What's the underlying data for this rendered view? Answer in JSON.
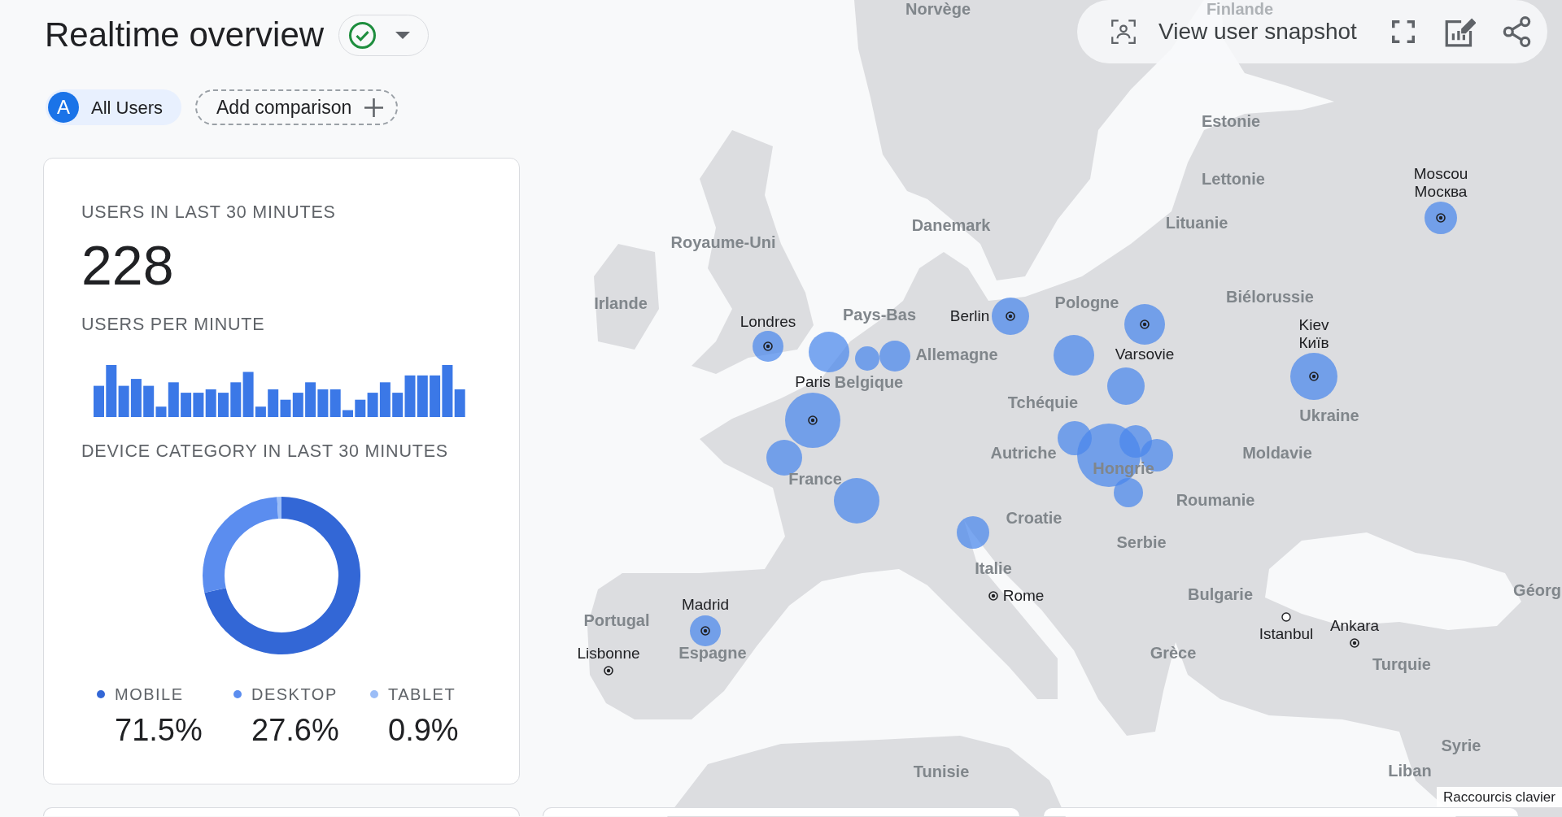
{
  "header": {
    "title": "Realtime overview",
    "status_ok": true
  },
  "comparisons": {
    "segments": [
      {
        "letter": "A",
        "label": "All Users"
      }
    ],
    "add_label": "Add comparison"
  },
  "toolbar": {
    "snapshot_label": "View user snapshot"
  },
  "realtime_card": {
    "users_label": "USERS IN LAST 30 MINUTES",
    "users_value": "228",
    "per_minute_label": "USERS PER MINUTE",
    "device_label": "DEVICE CATEGORY IN LAST 30 MINUTES",
    "device_chart": {
      "chart_data": {
        "type": "donut",
        "values": [
          71.5,
          27.6,
          0.9
        ]
      }
    },
    "legend": [
      {
        "label": "MOBILE",
        "value": "71.5%",
        "color": "#3367d6"
      },
      {
        "label": "DESKTOP",
        "value": "27.6%",
        "color": "#5b8def"
      },
      {
        "label": "TABLET",
        "value": "0.9%",
        "color": "#9bbdf7"
      }
    ]
  },
  "map": {
    "countries": [
      "Norvège",
      "Finlande",
      "Estonie",
      "Lettonie",
      "Danemark",
      "Lituanie",
      "Royaume-Uni",
      "Biélorussie",
      "Irlande",
      "Pologne",
      "Pays-Bas",
      "Allemagne",
      "Belgique",
      "Tchéquie",
      "Ukraine",
      "Autriche",
      "Moldavie",
      "Hongrie",
      "France",
      "Roumanie",
      "Croatie",
      "Serbie",
      "Italie",
      "Géorg",
      "Bulgarie",
      "Portugal",
      "Espagne",
      "Grèce",
      "Turquie",
      "Syrie",
      "Liban",
      "Tunisie"
    ],
    "cities": [
      {
        "name": "Moscou",
        "native_name": "Москва",
        "kind": "capital"
      },
      {
        "name": "Berlin",
        "kind": "capital"
      },
      {
        "name": "Londres",
        "kind": "capital"
      },
      {
        "name": "Varsovie",
        "kind": "capital"
      },
      {
        "name": "Kiev",
        "native_name": "Київ",
        "kind": "capital"
      },
      {
        "name": "Paris",
        "kind": "capital"
      },
      {
        "name": "Rome",
        "kind": "capital"
      },
      {
        "name": "Madrid",
        "kind": "capital"
      },
      {
        "name": "Lisbonne",
        "kind": "capital"
      },
      {
        "name": "Istanbul",
        "kind": "city"
      },
      {
        "name": "Ankara",
        "kind": "capital"
      }
    ],
    "shortcuts_label": "Raccourcis clavier"
  }
}
